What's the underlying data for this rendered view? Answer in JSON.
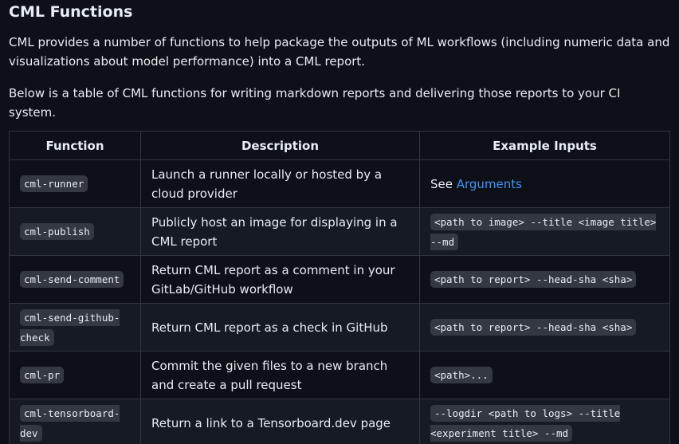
{
  "heading": "CML Functions",
  "intro": "CML provides a number of functions to help package the outputs of ML workflows (including numeric data and visualizations about model performance) into a CML report.",
  "table_intro": "Below is a table of CML functions for writing markdown reports and delivering those reports to your CI system.",
  "table": {
    "headers": [
      "Function",
      "Description",
      "Example Inputs"
    ],
    "rows": [
      {
        "function": "cml-runner",
        "description": "Launch a runner locally or hosted by a cloud provider",
        "example_prefix": "See ",
        "example_link": "Arguments"
      },
      {
        "function": "cml-publish",
        "description": "Publicly host an image for displaying in a CML report",
        "example": "<path to image> --title <image title> --md"
      },
      {
        "function": "cml-send-comment",
        "description": "Return CML report as a comment in your GitLab/GitHub workflow",
        "example": "<path to report> --head-sha <sha>"
      },
      {
        "function": "cml-send-github-check",
        "description": "Return CML report as a check in GitHub",
        "example": "<path to report> --head-sha <sha>"
      },
      {
        "function": "cml-pr",
        "description": "Commit the given files to a new branch and create a pull request",
        "example": "<path>..."
      },
      {
        "function": "cml-tensorboard-dev",
        "description": "Return a link to a Tensorboard.dev page",
        "example": "--logdir <path to logs> --title <experiment title> --md"
      }
    ]
  },
  "colors": {
    "background": "#0d1117",
    "alt_row": "#161b22",
    "border": "#30363d",
    "text": "#e6edf3",
    "link": "#4493f8",
    "code_bg": "#343941"
  }
}
